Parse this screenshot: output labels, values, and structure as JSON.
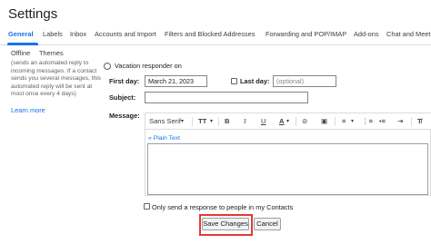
{
  "header": {
    "title": "Settings"
  },
  "tabs": [
    {
      "label": "General",
      "active": true
    },
    {
      "label": "Labels"
    },
    {
      "label": "Inbox"
    },
    {
      "label": "Accounts and Import"
    },
    {
      "label": "Filters and Blocked Addresses"
    },
    {
      "label": "Forwarding and POP/IMAP"
    },
    {
      "label": "Add-ons"
    },
    {
      "label": "Chat and Meet"
    }
  ],
  "subtabs": [
    {
      "label": "Offline"
    },
    {
      "label": "Themes"
    }
  ],
  "left": {
    "description": "(sends an automated reply to incoming messages. If a contact sends you several messages, this automated reply will be sent at most once every 4 days)",
    "learn_more": "Learn more"
  },
  "vacation": {
    "off_label": "Vacation responder on",
    "first_day_label": "First day:",
    "first_day_value": "March 21, 2023",
    "last_day_label": "Last day:",
    "last_day_placeholder": "(optional)",
    "subject_label": "Subject:",
    "message_label": "Message:",
    "plain_text_link": "« Plain Text",
    "only_contacts_label": "Only send a response to people in my Contacts"
  },
  "toolbar": {
    "font": "Sans Serif",
    "font_caret": "▾",
    "size_icon": "TT",
    "bold": "B",
    "italic": "I",
    "underline": "U",
    "color": "A",
    "link": "⊘",
    "image": "▣",
    "align": "≡",
    "clear": "T̸"
  },
  "buttons": {
    "save": "Save Changes",
    "cancel": "Cancel"
  },
  "colors": {
    "accent": "#1a73e8",
    "highlight": "#e53935"
  }
}
